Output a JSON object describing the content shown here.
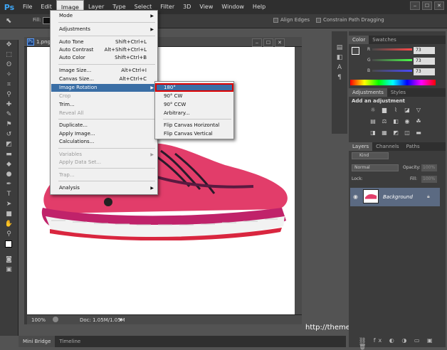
{
  "menubar": {
    "logo": "Ps",
    "items": [
      "File",
      "Edit",
      "Image",
      "Layer",
      "Type",
      "Select",
      "Filter",
      "3D",
      "View",
      "Window",
      "Help"
    ]
  },
  "window_controls": [
    "‒",
    "☐",
    "✕"
  ],
  "options": {
    "fill_label": "Fill:",
    "align_edges": "Align Edges",
    "constrain": "Constrain Path Dragging"
  },
  "document": {
    "tab": "1.png",
    "zoom": "100%",
    "doc_info": "Doc: 1.05M/1.05M"
  },
  "image_menu": {
    "items": [
      {
        "label": "Mode",
        "arrow": "▶"
      },
      {
        "label": "Adjustments",
        "arrow": "▶"
      },
      {
        "label": "Auto Tone",
        "shortcut": "Shift+Ctrl+L"
      },
      {
        "label": "Auto Contrast",
        "shortcut": "Alt+Shift+Ctrl+L"
      },
      {
        "label": "Auto Color",
        "shortcut": "Shift+Ctrl+B"
      },
      {
        "label": "Image Size...",
        "shortcut": "Alt+Ctrl+I"
      },
      {
        "label": "Canvas Size...",
        "shortcut": "Alt+Ctrl+C"
      },
      {
        "label": "Image Rotation",
        "arrow": "▶"
      },
      {
        "label": "Crop"
      },
      {
        "label": "Trim..."
      },
      {
        "label": "Reveal All"
      },
      {
        "label": "Duplicate..."
      },
      {
        "label": "Apply Image..."
      },
      {
        "label": "Calculations..."
      },
      {
        "label": "Variables",
        "arrow": "▶"
      },
      {
        "label": "Apply Data Set..."
      },
      {
        "label": "Trap..."
      },
      {
        "label": "Analysis",
        "arrow": "▶"
      }
    ]
  },
  "rotation_menu": {
    "items": [
      "180°",
      "90° CW",
      "90° CCW",
      "Arbitrary...",
      "Flip Canvas Horizontal",
      "Flip Canvas Vertical"
    ]
  },
  "color_panel": {
    "tabs": [
      "Color",
      "Swatches"
    ],
    "channels": [
      {
        "label": "R",
        "value": "73"
      },
      {
        "label": "G",
        "value": "73"
      },
      {
        "label": "B",
        "value": "73"
      }
    ]
  },
  "adjustments_panel": {
    "tabs": [
      "Adjustments",
      "Styles"
    ],
    "heading": "Add an adjustment"
  },
  "layers_panel": {
    "tabs": [
      "Layers",
      "Channels",
      "Paths"
    ],
    "kind": "Kind",
    "blend": "Normal",
    "opacity_label": "Opacity:",
    "opacity": "100%",
    "lock_label": "Lock:",
    "fill_label": "Fill:",
    "fill": "100%",
    "layer_name": "Background"
  },
  "bottom_tabs": [
    "Mini Bridge",
    "Timeline"
  ],
  "watermark": "http://themecreator.tistory.com"
}
